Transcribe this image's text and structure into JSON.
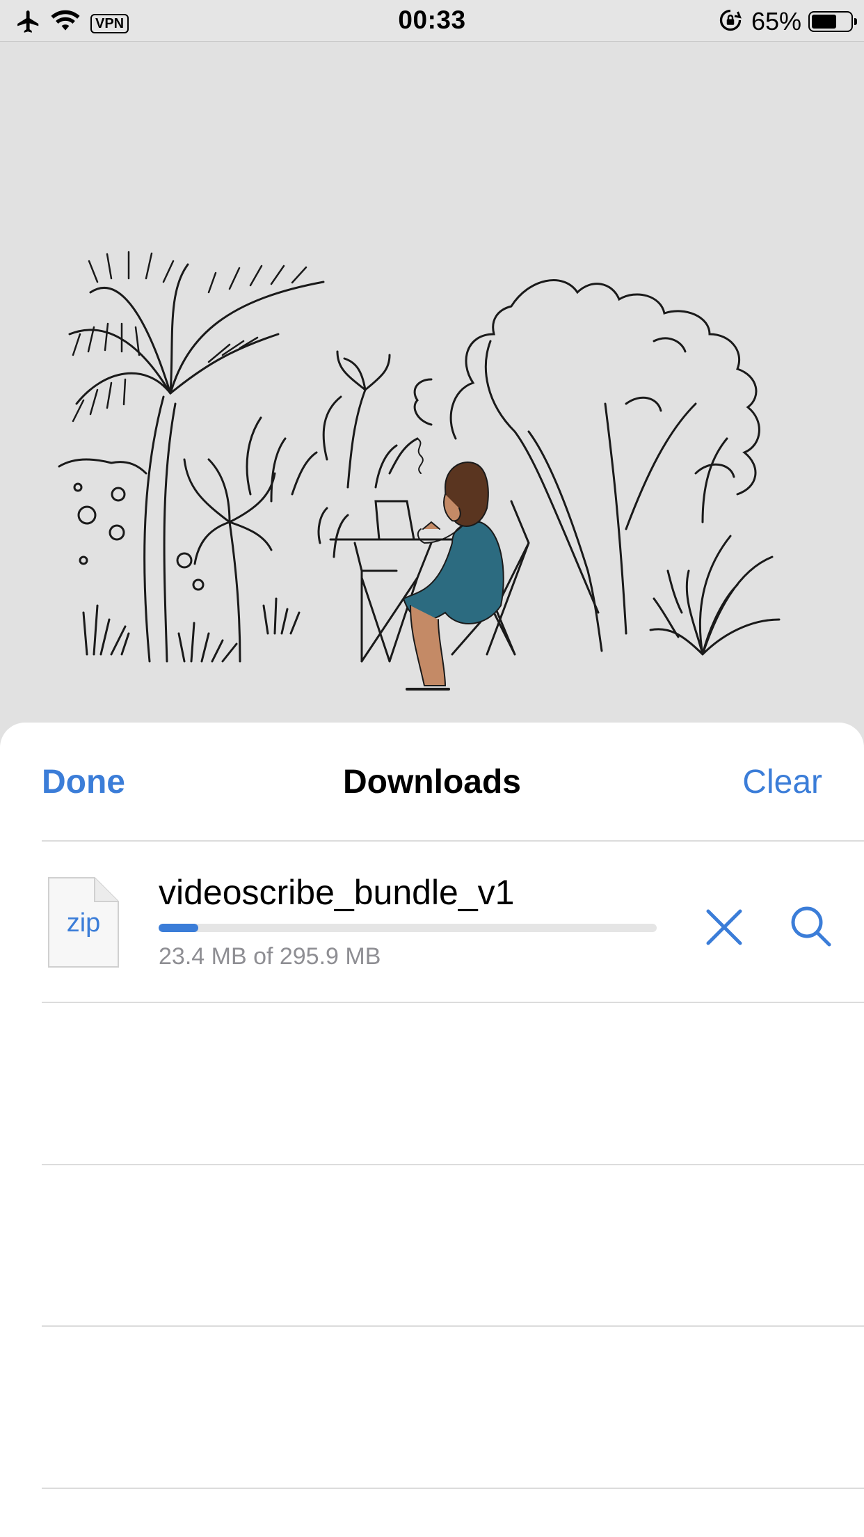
{
  "status_bar": {
    "time": "00:33",
    "vpn_label": "VPN",
    "battery_percent": "65%",
    "battery_level": 0.65,
    "icons": [
      "airplane-icon",
      "wifi-icon",
      "vpn-badge",
      "orientation-lock-icon",
      "battery-icon"
    ]
  },
  "illustration": {
    "description_icon": "illustration-woman-at-cafe-table-icon"
  },
  "nav": {
    "done_label": "Done",
    "title": "Downloads",
    "clear_label": "Clear"
  },
  "downloads": [
    {
      "file_type": "zip",
      "name": "videoscribe_bundle_v1",
      "progress": 0.079,
      "size_text": "23.4 MB of 295.9 MB"
    }
  ],
  "colors": {
    "accent": "#3b7dd8",
    "secondary_text": "#8e8e93",
    "background": "#e1e1e1",
    "sheet": "#ffffff",
    "dress": "#2c6b80",
    "skin": "#c48a66"
  }
}
